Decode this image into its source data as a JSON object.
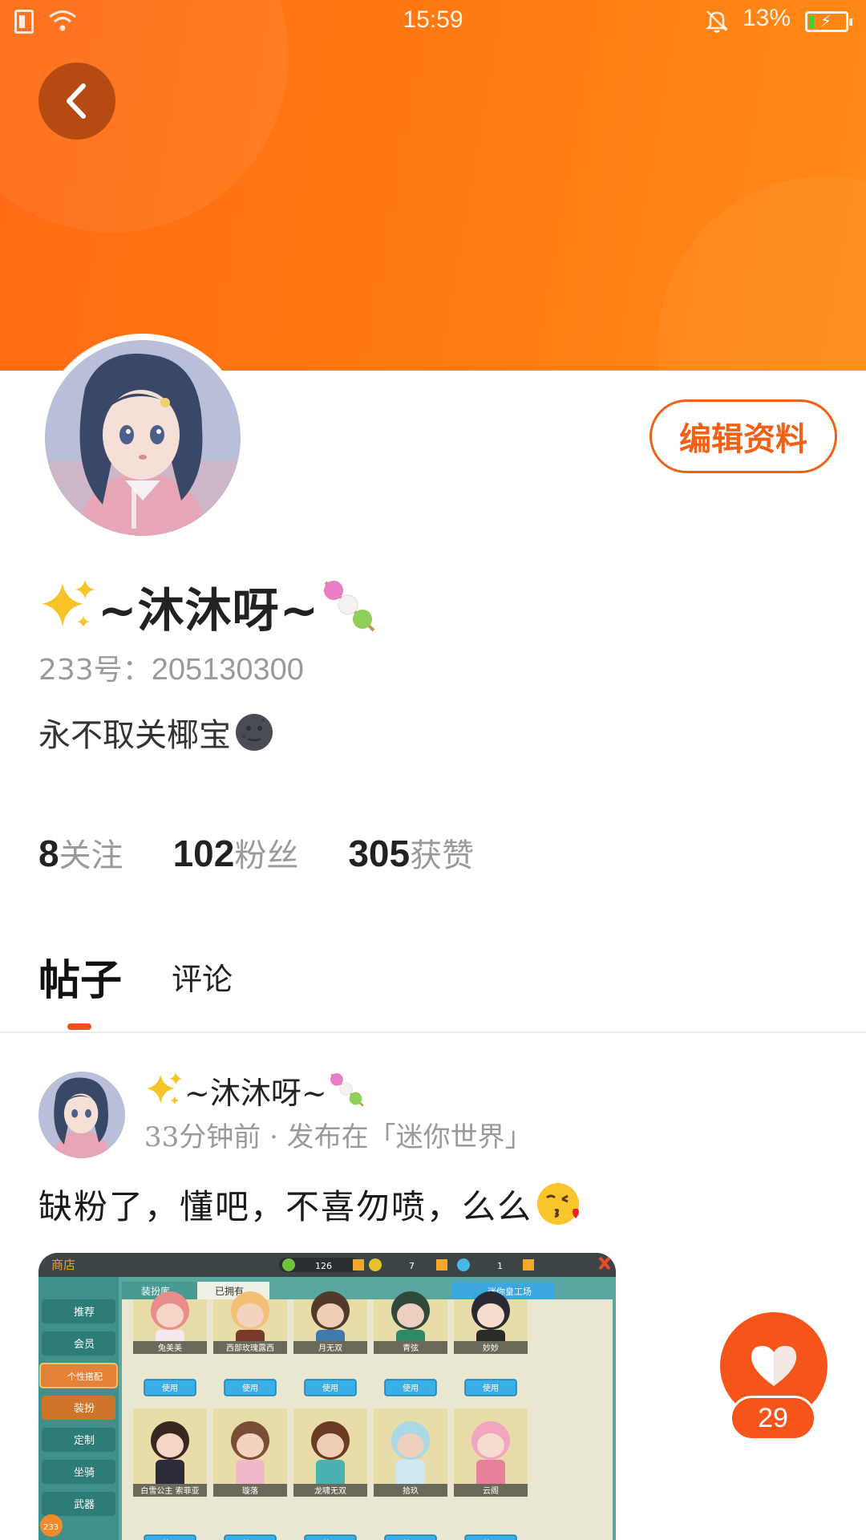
{
  "status_bar": {
    "time": "15:59",
    "battery_percent": "13%",
    "battery_level": 0.13
  },
  "header": {
    "back_icon": "chevron-left-icon",
    "edit_profile_label": "编辑资料",
    "accent_color": "#ff7512"
  },
  "profile": {
    "name": "~沐沐呀~",
    "id_label": "233号：",
    "id_value": "205130300",
    "bio": "永不取关椰宝",
    "name_prefix_icon": "sparkles-icon",
    "name_suffix_icon": "dango-icon",
    "bio_icon": "new-moon-face-icon"
  },
  "stats": [
    {
      "value": "8",
      "label": "关注"
    },
    {
      "value": "102",
      "label": "粉丝"
    },
    {
      "value": "305",
      "label": "获赞"
    }
  ],
  "tabs": [
    {
      "label": "帖子",
      "active": true
    },
    {
      "label": "评论",
      "active": false
    }
  ],
  "post": {
    "author": "~沐沐呀~",
    "meta": "33分钟前 · 发布在「迷你世界」",
    "text": "缺粉了，懂吧，不喜勿喷，么么",
    "text_emoji": "kissing-face-icon",
    "image": {
      "shop_title": "商店",
      "currency_1": "126",
      "currency_2": "7",
      "currency_3": "1",
      "tab_wardrobe": "装扮库",
      "tab_owned": "已拥有",
      "workshop": "迷你皇工场",
      "sidebar": [
        "推荐",
        "会员",
        "个性搭配",
        "装扮",
        "定制",
        "坐骑",
        "武器"
      ],
      "row1": [
        "兔美美",
        "西部玫瑰露西",
        "月无双",
        "青弦",
        "妙妙"
      ],
      "row2": [
        "白雪公主 索菲亚",
        "璇落",
        "龙啸无双",
        "拾玖",
        "云阁"
      ],
      "use_label": "使用",
      "badge": "233"
    }
  },
  "like": {
    "icon": "heart-icon",
    "count": "29"
  }
}
